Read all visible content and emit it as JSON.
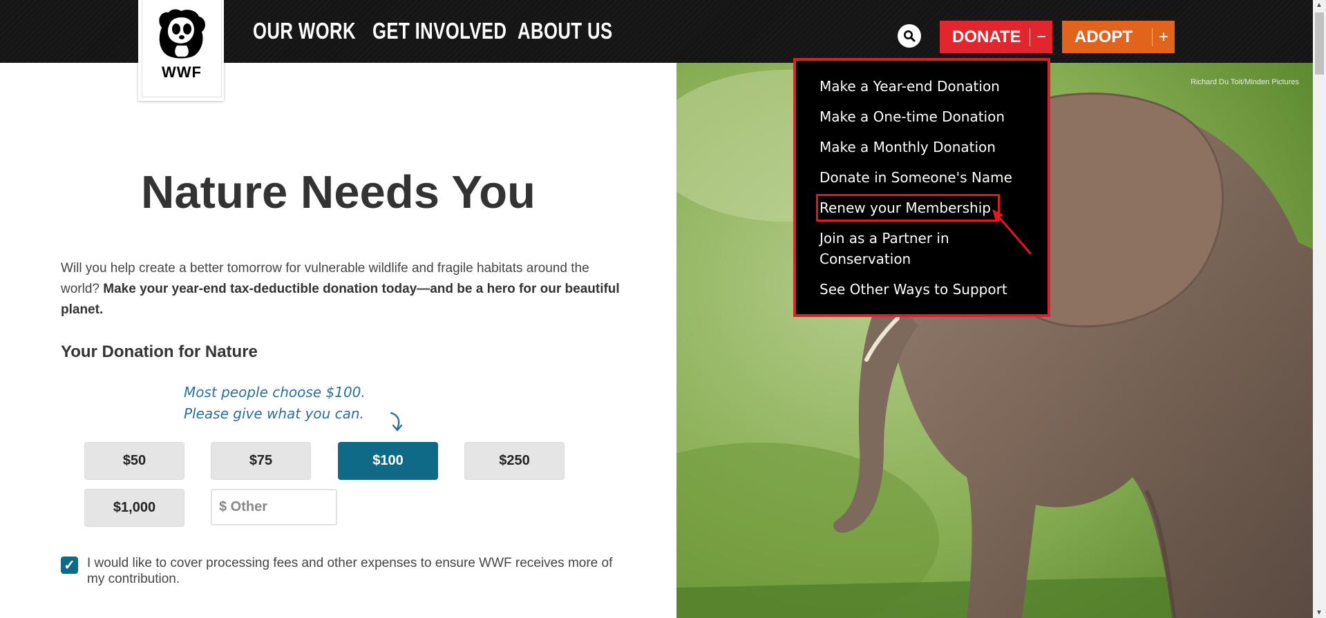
{
  "header": {
    "logo_text": "WWF",
    "nav": [
      "OUR WORK",
      "GET INVOLVED",
      "ABOUT US"
    ],
    "donate_label": "DONATE",
    "donate_toggle": "−",
    "adopt_label": "ADOPT",
    "adopt_toggle": "+"
  },
  "donate_menu": {
    "items": [
      "Make a Year-end Donation",
      "Make a One-time Donation",
      "Make a Monthly Donation",
      "Donate in Someone's Name",
      "Renew your Membership",
      "Join as a Partner in Conservation",
      "See Other Ways to Support"
    ],
    "highlighted_index": 4
  },
  "hero": {
    "credit": "Richard Du Toit/Minden Pictures"
  },
  "main": {
    "title": "Nature Needs You",
    "intro_plain": "Will you help create a better tomorrow for vulnerable wildlife and fragile habitats around the world?",
    "intro_bold": "Make your year-end tax-deductible donation today—and be a hero for our beautiful planet.",
    "subhead": "Your Donation for Nature",
    "hint_line1": "Most people choose $100.",
    "hint_line2": "Please give what you can.",
    "amounts": [
      "$50",
      "$75",
      "$100",
      "$250",
      "$1,000"
    ],
    "selected_amount": "$100",
    "other_placeholder": "$ Other",
    "fees_label": "I would like to cover processing fees and other expenses to ensure WWF receives more of my contribution.",
    "fees_checked": true
  },
  "colors": {
    "donate": "#e1262d",
    "adopt": "#e2631c",
    "selected_amount": "#0f6a87",
    "hint": "#2a6f9b",
    "highlight_outline": "#e3191f"
  }
}
